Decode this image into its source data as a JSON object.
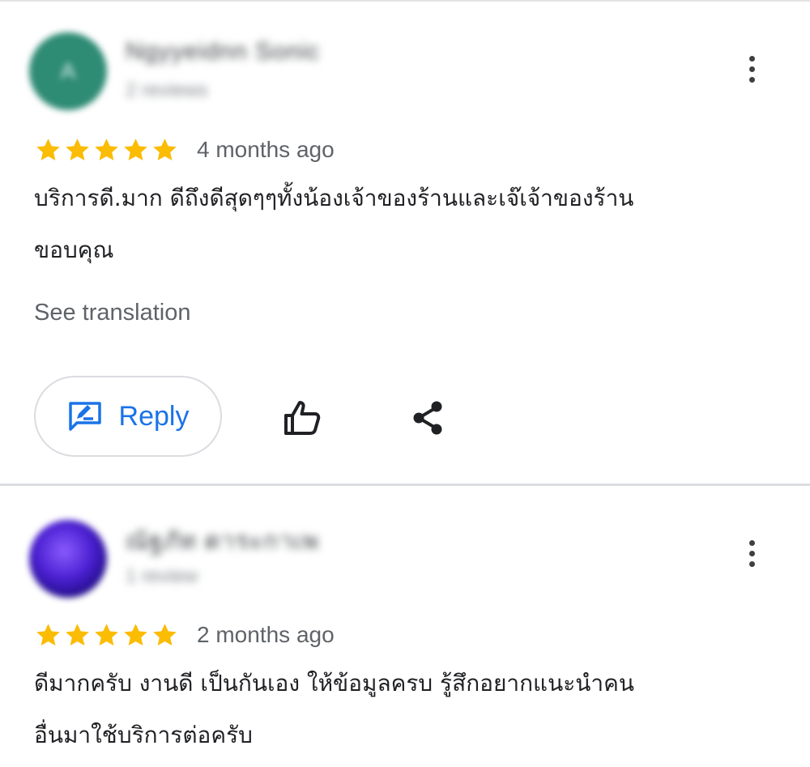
{
  "reviews": [
    {
      "reviewer_name": "Ngyyeidnn Sonic",
      "reviewer_sub": "2 reviews",
      "avatar_letter": "A",
      "stars": 5,
      "date": "4 months ago",
      "text_lines": [
        "บริการดี.มาก ดีถึงดีสุดๆๆทั้งน้องเจ้าของร้านและเจ๊เจ้าของร้าน",
        "ขอบคุณ"
      ],
      "see_translation": "See translation",
      "reply_label": "Reply"
    },
    {
      "reviewer_name": "ณัฐภัท ตาระกาเพ",
      "reviewer_sub": "1 review",
      "stars": 5,
      "date": "2 months ago",
      "text_lines": [
        "ดีมากครับ งานดี เป็นกันเอง ให้ข้อมูลครบ รู้สึกอยากแนะนำคน",
        "อื่นมาใช้บริการต่อครับ"
      ]
    }
  ],
  "icons": {
    "star": "star-icon",
    "more": "more-vert-icon",
    "reply": "rate-review-icon",
    "like": "thumb-up-icon",
    "share": "share-icon"
  },
  "colors": {
    "star": "#fbbc04",
    "accent": "#1a73e8",
    "divider": "#dadce0"
  }
}
